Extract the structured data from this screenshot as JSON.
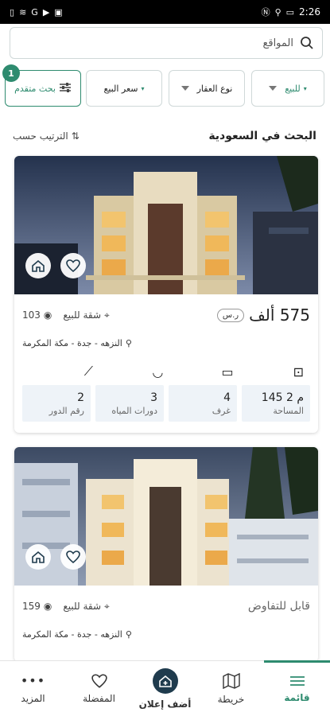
{
  "status_bar": {
    "time": "2:26",
    "icons_left": [
      "sim-icon",
      "wifi-icon",
      "g-icon",
      "play-icon",
      "youtube-icon"
    ],
    "icons_right": [
      "nfc-icon",
      "location-icon",
      "battery-icon"
    ]
  },
  "search": {
    "placeholder": "المواقع"
  },
  "filters": {
    "advanced": {
      "label": "بحث متقدم",
      "badge": "1"
    },
    "price": {
      "label": "سعر البيع"
    },
    "property_type": {
      "label": "نوع العقار"
    },
    "purpose": {
      "label": "للبيع"
    }
  },
  "results": {
    "title": "البحث في السعودية",
    "sort_label": "الترتيب حسب"
  },
  "listings": [
    {
      "price": "575 ألف",
      "currency": "ر.س",
      "category": "شقة للبيع",
      "views": "103",
      "location": "النزهه - جدة - مكة المكرمة",
      "specs": {
        "area": {
          "value": "145 م 2",
          "label": "المساحة"
        },
        "rooms": {
          "value": "4",
          "label": "غرف"
        },
        "bathrooms": {
          "value": "3",
          "label": "دورات المياه"
        },
        "floor": {
          "value": "2",
          "label": "رقم الدور"
        }
      }
    },
    {
      "price_text": "قابل للتفاوض",
      "category": "شقة للبيع",
      "views": "159",
      "location": "النزهه - جدة - مكة المكرمة"
    }
  ],
  "bottom_nav": {
    "list": "قائمة",
    "map": "خريطة",
    "add": "أضف إعلان",
    "favorites": "المفضلة",
    "more": "المزيد"
  },
  "colors": {
    "accent": "#2e8b6f",
    "add_button": "#1f3b4d",
    "spec_bg": "#eef3f8"
  }
}
